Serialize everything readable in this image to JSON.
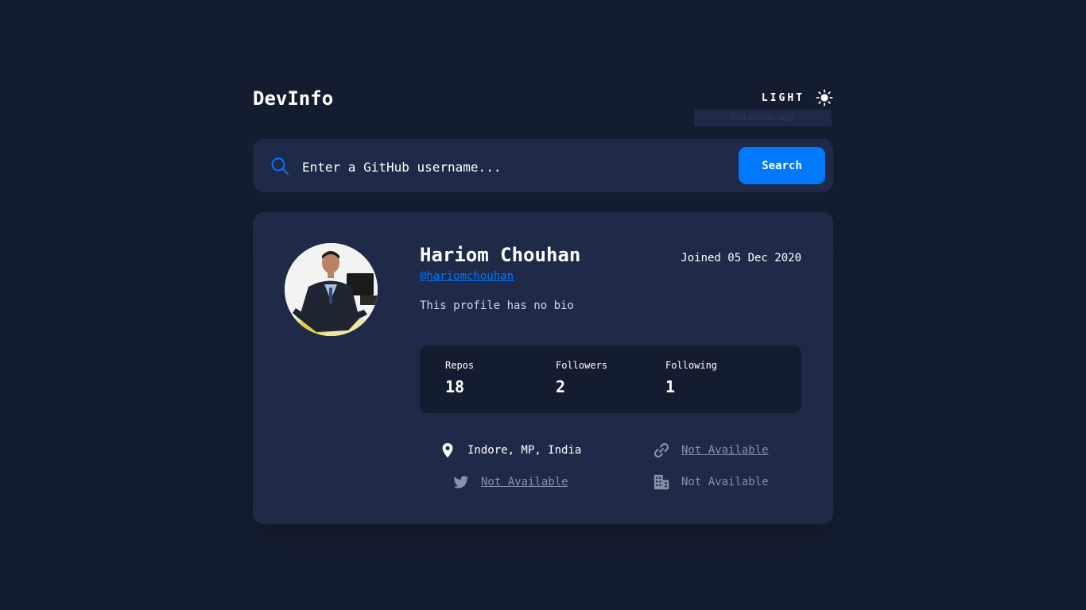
{
  "header": {
    "logo": "DevInfo",
    "theme_label": "LIGHT",
    "theme_icon": "sun-icon",
    "tooltip": "Full-screen Snip"
  },
  "search": {
    "placeholder": "Enter a GitHub username...",
    "button_label": "Search",
    "icon": "search-icon"
  },
  "profile": {
    "name": "Hariom Chouhan",
    "username": "@hariomchouhan",
    "joined": "Joined 05 Dec 2020",
    "bio": "This profile has no bio",
    "stats": [
      {
        "label": "Repos",
        "value": "18"
      },
      {
        "label": "Followers",
        "value": "2"
      },
      {
        "label": "Following",
        "value": "1"
      }
    ],
    "info": {
      "location": "Indore, MP, India",
      "blog": "Not Available",
      "twitter": "Not Available",
      "company": "Not Available"
    }
  },
  "colors": {
    "background": "#141d2f",
    "card": "#1e2a47",
    "accent": "#0079ff",
    "muted": "#8592a8"
  }
}
